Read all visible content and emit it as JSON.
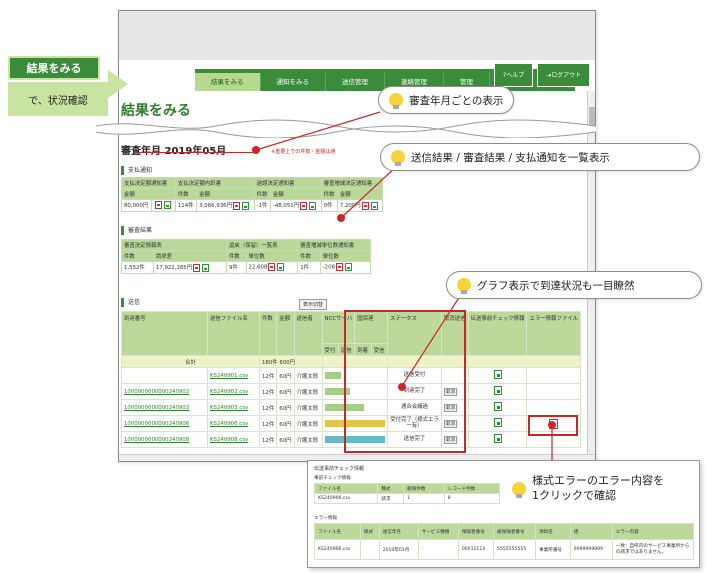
{
  "callout_label": {
    "title": "結果をみる",
    "subtitle": "で、状況確認"
  },
  "nav": {
    "tabs": [
      "結果をみる",
      "通知をみる",
      "送信管理",
      "連絡管理",
      "管理"
    ],
    "help": "ヘルプ",
    "logout": "ログアウト"
  },
  "page": {
    "title": "結果をみる",
    "period": "審査年月 2019年05月",
    "period_note": "※重要上での件数・金額は通"
  },
  "payment": {
    "section": "支払通知",
    "headers": [
      "支払決定額通知書",
      "支払決定額内訳書",
      "",
      "過誤決定通知書",
      "",
      "",
      "審査増減決定通知書",
      ""
    ],
    "subheaders": [
      "金額",
      "",
      "件数",
      "金額",
      "",
      "件数",
      "金額",
      "",
      "件数",
      "金額"
    ],
    "row": [
      "80,000円",
      "114件",
      "3,066,936円",
      "-1件",
      "-48,051円",
      "0件",
      "7,200円"
    ]
  },
  "review": {
    "section": "審査結果",
    "headers": [
      "審査決定情報表",
      "返戻（保留）一覧表",
      "審査増減単位数通知書"
    ],
    "subheaders": [
      "件数",
      "請求差",
      "件数",
      "単位数",
      "件数",
      "単位数"
    ],
    "row": [
      "1,552件",
      "17,922,285円",
      "9件",
      "22,608",
      "1件",
      "-208"
    ]
  },
  "transmit": {
    "section": "送信",
    "toggle": "表示切替",
    "headers": {
      "arrival": "到達番号",
      "file": "送信ファイル名",
      "count": "件数",
      "amount": "金額",
      "sender": "送信者",
      "ncc": "NCCサーバ",
      "kokuho": "国保連",
      "status": "ステータス",
      "cancel": "取消送信",
      "check": "伝送事前チェック情報",
      "error": "エラー情報ファイル",
      "sub": [
        "受付",
        "送信",
        "到着",
        "受信"
      ]
    },
    "total_label": "合計",
    "total_value": "180件 600円",
    "rows": [
      {
        "arrival": "",
        "file": "KS240901.csv",
        "count": "12件",
        "amount": "60円",
        "sender": "介護太郎",
        "bar": 0.28,
        "bar_color": "#a6cf83",
        "status": "送信受付",
        "cancel": ""
      },
      {
        "arrival": "1000000000000240902",
        "file": "KS240902.csv",
        "count": "12件",
        "amount": "60円",
        "sender": "介護太郎",
        "bar": 0.42,
        "bar_color": "#a6cf83",
        "status": "到達完了",
        "cancel": "取消"
      },
      {
        "arrival": "1000000000000240903",
        "file": "KS240903.csv",
        "count": "12件",
        "amount": "60円",
        "sender": "介護太郎",
        "bar": 0.66,
        "bar_color": "#a6cf83",
        "status": "通合会議過",
        "cancel": "取消"
      },
      {
        "arrival": "1000000000000240906",
        "file": "KS240906.csv",
        "count": "12件",
        "amount": "60円",
        "sender": "介護太郎",
        "bar": 1.0,
        "bar_color": "#e1c445",
        "status": "受付完了（様式エラー有）",
        "cancel": "取消"
      },
      {
        "arrival": "1000000000000240908",
        "file": "KS240908.csv",
        "count": "12件",
        "amount": "60円",
        "sender": "介護太郎",
        "bar": 1.0,
        "bar_color": "#67b9c9",
        "status": "送信完了",
        "cancel": "取消"
      }
    ]
  },
  "callouts": {
    "c1": "審査年月ごとの表示",
    "c2": "送信結果 / 審査結果 / 支払通知を一覧表示",
    "c3": "グラフ表示で到達状況も一目瞭然",
    "c4_line1": "様式エラーのエラー内容を",
    "c4_line2": "1クリックで確認"
  },
  "popup": {
    "title": "伝送事前チェック情報",
    "sub1": "事前チェック情報",
    "t1_headers": [
      "ファイル名",
      "種式",
      "軽微件数",
      "レコード件数"
    ],
    "t1_row": [
      "KS240906.csv",
      "請求",
      "1",
      "8"
    ],
    "sub2": "エラー情報",
    "t2_headers": [
      "ファイル名",
      "様式",
      "送信年月",
      "サービス種類",
      "保険者番号",
      "被保険者番号",
      "項目名",
      "値",
      "エラー内容"
    ],
    "t2_row": [
      "KS240906.csv",
      "",
      "2019年01月",
      "-",
      "00011114",
      "5555555555",
      "事業所番号",
      "9999999999",
      "一致：自県内のサービス事業所からの請求ではありません。"
    ]
  },
  "colors": {
    "brand": "#3a8b3a",
    "header": "#b9d89a",
    "highlight": "#c82828"
  }
}
